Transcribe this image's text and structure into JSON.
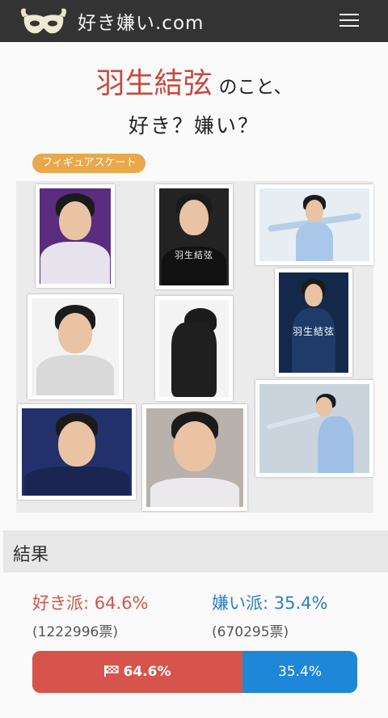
{
  "header": {
    "brand": "好き嫌い.com",
    "logo_icon": "masquerade-mask-logo-icon",
    "menu_icon": "hamburger-menu-icon"
  },
  "title": {
    "name": "羽生結弦",
    "suffix": "のこと、",
    "question": "好き？嫌い？"
  },
  "category_tag": "フィギュアスケート",
  "gallery": {
    "photos": [
      {
        "caption": ""
      },
      {
        "caption": "羽生結弦"
      },
      {
        "caption": ""
      },
      {
        "caption": ""
      },
      {
        "caption": ""
      },
      {
        "caption": "羽生結弦"
      },
      {
        "caption": ""
      },
      {
        "caption": ""
      },
      {
        "caption": ""
      }
    ]
  },
  "results": {
    "heading": "結果",
    "like_label": "好き派: 64.6%",
    "dislike_label": "嫌い派: 35.4%",
    "like_votes": "(1222996票)",
    "dislike_votes": "(670295票)",
    "like_bar_text": "64.6%",
    "dislike_bar_text": "35.4%",
    "like_fraction": 0.646,
    "colors": {
      "like": "#d6544c",
      "dislike": "#1f87d8",
      "tag": "#e9a84b"
    }
  }
}
